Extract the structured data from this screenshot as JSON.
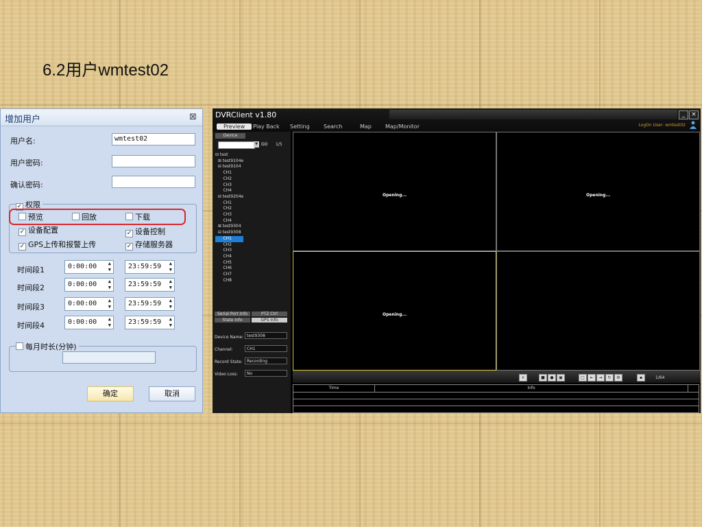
{
  "slide": {
    "title": "6.2用户wmtest02"
  },
  "dialog": {
    "title": "增加用户",
    "close_icon": "close-icon",
    "username_label": "用户名:",
    "username_value": "wmtest02",
    "password_label": "用户密码:",
    "password_value": "",
    "confirm_label": "确认密码:",
    "confirm_value": "",
    "permissions": {
      "legend": "权限",
      "legend_checked": true,
      "preview": {
        "label": "预览",
        "checked": false
      },
      "playback": {
        "label": "回放",
        "checked": false
      },
      "download": {
        "label": "下载",
        "checked": false
      },
      "device_config": {
        "label": "设备配置",
        "checked": true
      },
      "device_control": {
        "label": "设备控制",
        "checked": true
      },
      "gps_upload": {
        "label": "GPS上传和报警上传",
        "checked": true
      },
      "storage_server": {
        "label": "存储服务器",
        "checked": true
      }
    },
    "periods": [
      {
        "label": "时间段1",
        "start": "0:00:00",
        "end": "23:59:59"
      },
      {
        "label": "时间段2",
        "start": "0:00:00",
        "end": "23:59:59"
      },
      {
        "label": "时间段3",
        "start": "0:00:00",
        "end": "23:59:59"
      },
      {
        "label": "时间段4",
        "start": "0:00:00",
        "end": "23:59:59"
      }
    ],
    "monthly": {
      "label": "每月时长(分钟)",
      "checked": false,
      "value": ""
    },
    "ok_label": "确定",
    "cancel_label": "取消"
  },
  "dvr": {
    "title": "DVRClient v1.80",
    "menu": [
      "Preview",
      "Play Back",
      "Setting",
      "Search",
      "Map",
      "Map/Monitor"
    ],
    "active_menu": "Preview",
    "logon_label": "LogOn User:",
    "logon_user": "wmtest02",
    "device_tab": "Device",
    "go_label": "GO",
    "page_indicator": "1/5",
    "tree": [
      "⊟ test",
      "  ⊞ test9104e",
      "  ⊟ test9104",
      "      CH1",
      "      CH2",
      "      CH3",
      "      CH4",
      "  ⊟ test9204e",
      "      CH1",
      "      CH2",
      "      CH3",
      "      CH4",
      "  ⊞ test9304",
      "  ⊟ test9308",
      "      CH1",
      "      CH2",
      "      CH3",
      "      CH4",
      "      CH5",
      "      CH6",
      "      CH7",
      "      CH8"
    ],
    "selected_tree_index": 14,
    "tabs_lower": [
      "Serial Port Info",
      "PTZ Ctrl",
      "State Info",
      "GPS Info"
    ],
    "state": [
      {
        "label": "Device Name:",
        "value": "test9308"
      },
      {
        "label": "Channel:",
        "value": "CH1"
      },
      {
        "label": "Record State:",
        "value": "Recording"
      },
      {
        "label": "Video Loss:",
        "value": "No"
      }
    ],
    "opening_text": "Opening...",
    "page_count": "1/64",
    "log_headers": [
      "Time",
      "Info"
    ]
  }
}
